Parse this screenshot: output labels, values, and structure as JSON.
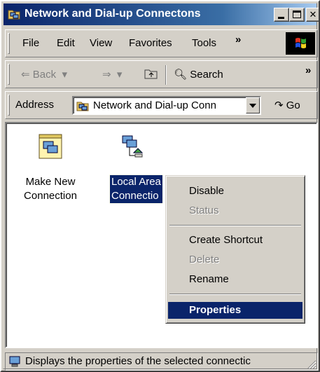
{
  "window": {
    "title": "Network and Dial-up Connectons"
  },
  "menubar": {
    "items": [
      "File",
      "Edit",
      "View",
      "Favorites",
      "Tools"
    ],
    "overflow": "»"
  },
  "toolbar": {
    "back_label": "Back",
    "search_label": "Search",
    "overflow": "»"
  },
  "address": {
    "label": "Address",
    "value": "Network and Dial-up Conn",
    "go_label": "Go"
  },
  "icons": [
    {
      "label_line1": "Make New",
      "label_line2": "Connection",
      "selected": false
    },
    {
      "label_line1": "Local Area",
      "label_line2": "Connectio",
      "selected": true
    }
  ],
  "context_menu": {
    "items": [
      {
        "label": "Disable",
        "state": "enabled"
      },
      {
        "label": "Status",
        "state": "disabled"
      },
      {
        "label": "Create Shortcut",
        "state": "enabled"
      },
      {
        "label": "Delete",
        "state": "disabled"
      },
      {
        "label": "Rename",
        "state": "enabled"
      },
      {
        "label": "Properties",
        "state": "highlighted"
      }
    ]
  },
  "statusbar": {
    "text": "Displays the properties of the selected connectic"
  },
  "colors": {
    "face": "#d4d0c8",
    "titlebar_start": "#0a246a",
    "titlebar_end": "#a6caf0",
    "selection": "#0a246a"
  }
}
